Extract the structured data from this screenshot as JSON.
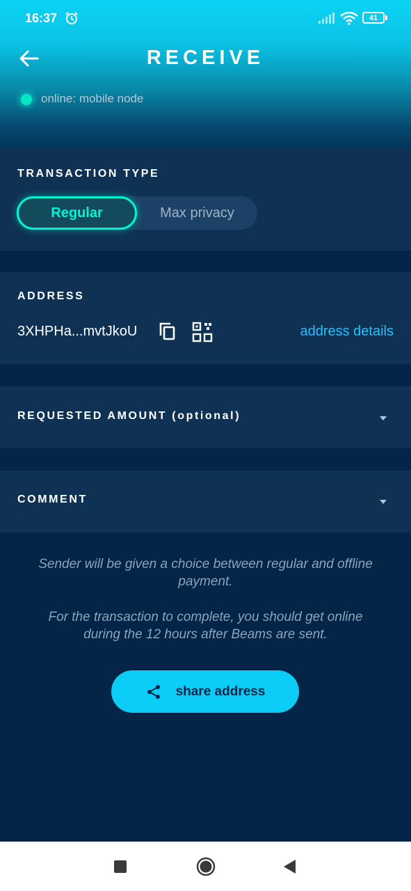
{
  "status_bar": {
    "time": "16:37",
    "battery": "41"
  },
  "header": {
    "title": "RECEIVE",
    "connection_status": "online: mobile node"
  },
  "transaction_type": {
    "label": "TRANSACTION TYPE",
    "options": [
      "Regular",
      "Max privacy"
    ],
    "selected": "Regular"
  },
  "address": {
    "label": "ADDRESS",
    "value": "3XHPHa...mvtJkoU",
    "details_link": "address details"
  },
  "requested_amount": {
    "label": "REQUESTED AMOUNT (optional)"
  },
  "comment": {
    "label": "COMMENT"
  },
  "info": {
    "line1": "Sender will be given a choice between regular and offline payment.",
    "line2": "For the transaction to complete, you should get online during the 12 hours after Beams are sent."
  },
  "share_button": {
    "label": "share address"
  },
  "colors": {
    "accent_teal": "#00f5d4",
    "accent_cyan": "#0ccdf6",
    "link_blue": "#24c1ff",
    "background": "#042548",
    "card": "#0f3254"
  }
}
